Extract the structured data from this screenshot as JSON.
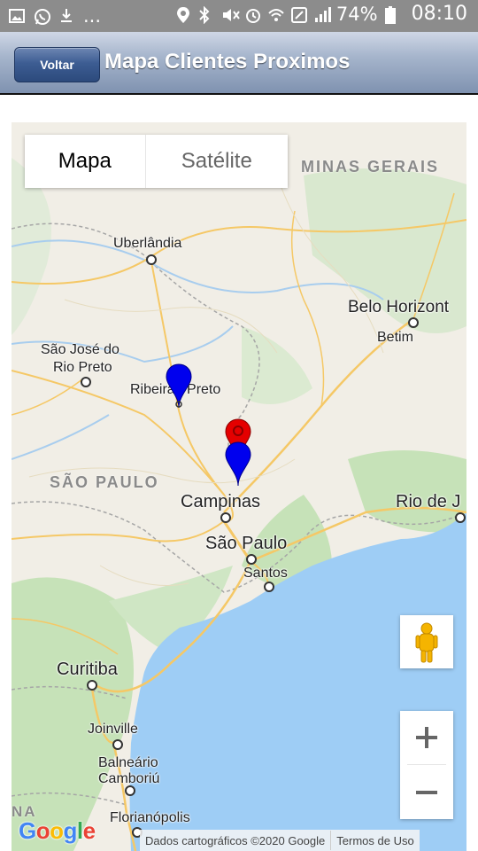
{
  "status_bar": {
    "dots": "...",
    "battery_text": "74%",
    "time": "08:10"
  },
  "header": {
    "back_label": "Voltar",
    "title": "Mapa Clientes Proximos"
  },
  "map": {
    "map_type_map": "Mapa",
    "map_type_satellite": "Satélite",
    "states": {
      "mg": "MINAS GERAIS",
      "sp": "SÃO PAULO"
    },
    "cities": {
      "uberlandia": "Uberlândia",
      "belo_horizonte": "Belo Horizont",
      "betim": "Betim",
      "sjrp_1": "São José do",
      "sjrp_2": "Rio Preto",
      "ribeirao": "Ribeirão Preto",
      "campinas": "Campinas",
      "sao_paulo": "São Paulo",
      "santos": "Santos",
      "rio": "Rio de J",
      "curitiba": "Curitiba",
      "joinville": "Joinville",
      "balneario_1": "Balneário",
      "balneario_2": "Camboriú",
      "florianopolis": "Florianópolis",
      "na": "NA"
    },
    "markers": [
      {
        "color": "#0000ff",
        "label": "blue-marker-ribeirao"
      },
      {
        "color": "#e00000",
        "label": "red-marker"
      },
      {
        "color": "#0000ff",
        "label": "blue-marker-campinas"
      }
    ],
    "zoom_in": "+",
    "zoom_out": "−",
    "google_logo": "Google",
    "attribution": "Dados cartográficos ©2020 Google",
    "terms": "Termos de Uso"
  }
}
